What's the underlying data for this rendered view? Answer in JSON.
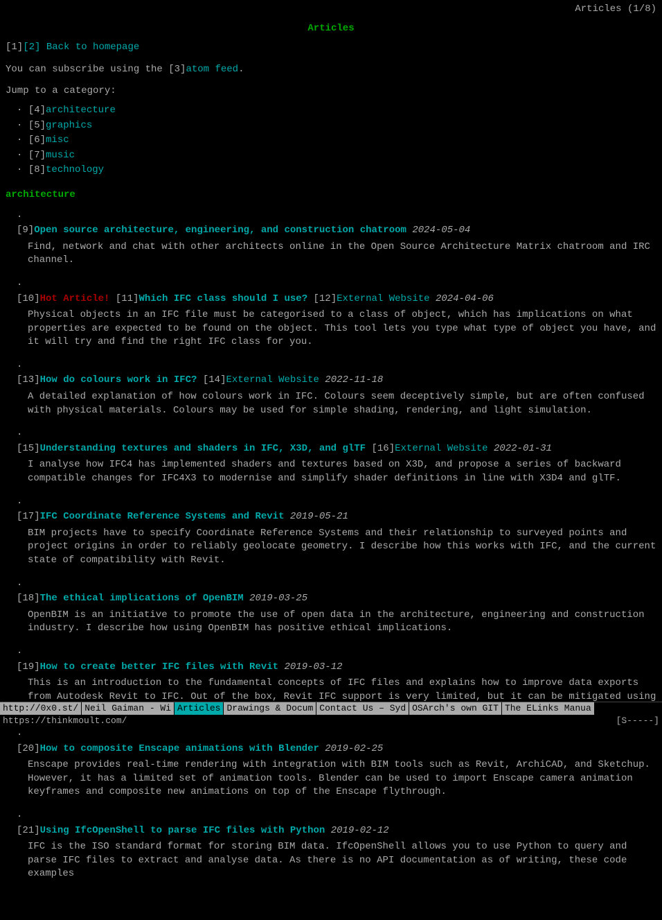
{
  "topbar": {
    "label": "Articles (1/8)"
  },
  "page": {
    "title": "Articles"
  },
  "nav": {
    "back_num": "[1]",
    "back_bracket_num": "[2]",
    "back_label": "Back to homepage",
    "subscribe_prefix": "You can subscribe using the ",
    "subscribe_num": "[3]",
    "subscribe_link": "atom feed",
    "subscribe_suffix": ".",
    "jump_label": "Jump to a category:"
  },
  "categories": [
    {
      "num": "[4]",
      "label": "architecture"
    },
    {
      "num": "[5]",
      "label": "graphics"
    },
    {
      "num": "[6]",
      "label": "misc"
    },
    {
      "num": "[7]",
      "label": "music"
    },
    {
      "num": "[8]",
      "label": "technology"
    }
  ],
  "sections": [
    {
      "id": "architecture",
      "heading": "architecture",
      "articles": [
        {
          "num": "[9]",
          "title": "Open source architecture, engineering, and construction chatroom",
          "date": "2024-05-04",
          "hot": false,
          "extra_num": null,
          "extra_label": null,
          "ext_num": null,
          "ext_label": null,
          "desc": "Find, network and chat with other architects online in the Open Source Architecture Matrix chatroom and IRC channel."
        },
        {
          "num": "[10]",
          "hot_label": "Hot Article!",
          "hot_num": "[11]",
          "title": "Which IFC class should I use?",
          "ext_num": "[12]",
          "ext_label": "External Website",
          "date": "2024-04-06",
          "hot": true,
          "desc": "Physical objects in an IFC file must be categorised to a class of object, which has implications on what properties are expected to be found on the object. This tool lets you type what type of object you have, and it will try and find the right IFC class for you."
        },
        {
          "num": "[13]",
          "title": "How do colours work in IFC?",
          "ext_num": "[14]",
          "ext_label": "External Website",
          "date": "2022-11-18",
          "hot": false,
          "desc": "A detailed explanation of how colours work in IFC. Colours seem deceptively simple, but are often confused with physical materials. Colours may be used for simple shading, rendering, and light simulation."
        },
        {
          "num": "[15]",
          "title": "Understanding textures and shaders in IFC, X3D, and glTF",
          "ext_num": "[16]",
          "ext_label": "External Website",
          "date": "2022-01-31",
          "hot": false,
          "desc": "I analyse how IFC4 has implemented shaders and textures based on X3D, and propose a series of backward compatible changes for IFC4X3 to modernise and simplify shader definitions in line with X3D4 and glTF."
        },
        {
          "num": "[17]",
          "title": "IFC Coordinate Reference Systems and Revit",
          "ext_num": null,
          "ext_label": null,
          "date": "2019-05-21",
          "hot": false,
          "desc": "BIM projects have to specify Coordinate Reference Systems and their relationship to surveyed points and project origins in order to reliably geolocate geometry. I describe how this works with IFC, and the current state of compatibility with Revit."
        },
        {
          "num": "[18]",
          "title": "The ethical implications of OpenBIM",
          "ext_num": null,
          "ext_label": null,
          "date": "2019-03-25",
          "hot": false,
          "desc": "OpenBIM is an initiative to promote the use of open data in the architecture, engineering and construction industry. I describe how using OpenBIM has positive ethical implications."
        },
        {
          "num": "[19]",
          "title": "How to create better IFC files with Revit",
          "ext_num": null,
          "ext_label": null,
          "date": "2019-03-12",
          "hot": false,
          "desc": "This is an introduction to the fundamental concepts of IFC files and explains how to improve data exports from Autodesk Revit to IFC. Out of the box, Revit IFC support is very limited, but it can be mitigated using an open-source plugin and understanding these undocumented quirks."
        },
        {
          "num": "[20]",
          "title": "How to composite Enscape animations with Blender",
          "ext_num": null,
          "ext_label": null,
          "date": "2019-02-25",
          "hot": false,
          "desc": "Enscape provides real-time rendering with integration with BIM tools such as Revit, ArchiCAD, and Sketchup. However, it has a limited set of animation tools. Blender can be used to import Enscape camera animation keyframes and composite new animations on top of the Enscape flythrough."
        },
        {
          "num": "[21]",
          "title": "Using IfcOpenShell to parse IFC files with Python",
          "ext_num": null,
          "ext_label": null,
          "date": "2019-02-12",
          "hot": false,
          "desc": "IFC is the ISO standard format for storing BIM data. IfcOpenShell allows you to use Python to query and parse IFC files to extract and analyse data. As there is no API documentation as of writing, these code examples"
        }
      ]
    }
  ],
  "statusbar": {
    "top_items": [
      {
        "label": "http://0x0.st/",
        "active": false
      },
      {
        "label": "Neil Gaiman - Wi",
        "active": false
      },
      {
        "label": "Articles",
        "active": true
      },
      {
        "label": "Drawings & Docum",
        "active": false
      },
      {
        "label": "Contact Us – Syd",
        "active": false
      },
      {
        "label": "OSArch's own GIT",
        "active": false
      },
      {
        "label": "The ELinks Manua",
        "active": false
      }
    ],
    "bottom_left": "https://thinkmoult.com/",
    "bottom_right": "[S-----]"
  }
}
